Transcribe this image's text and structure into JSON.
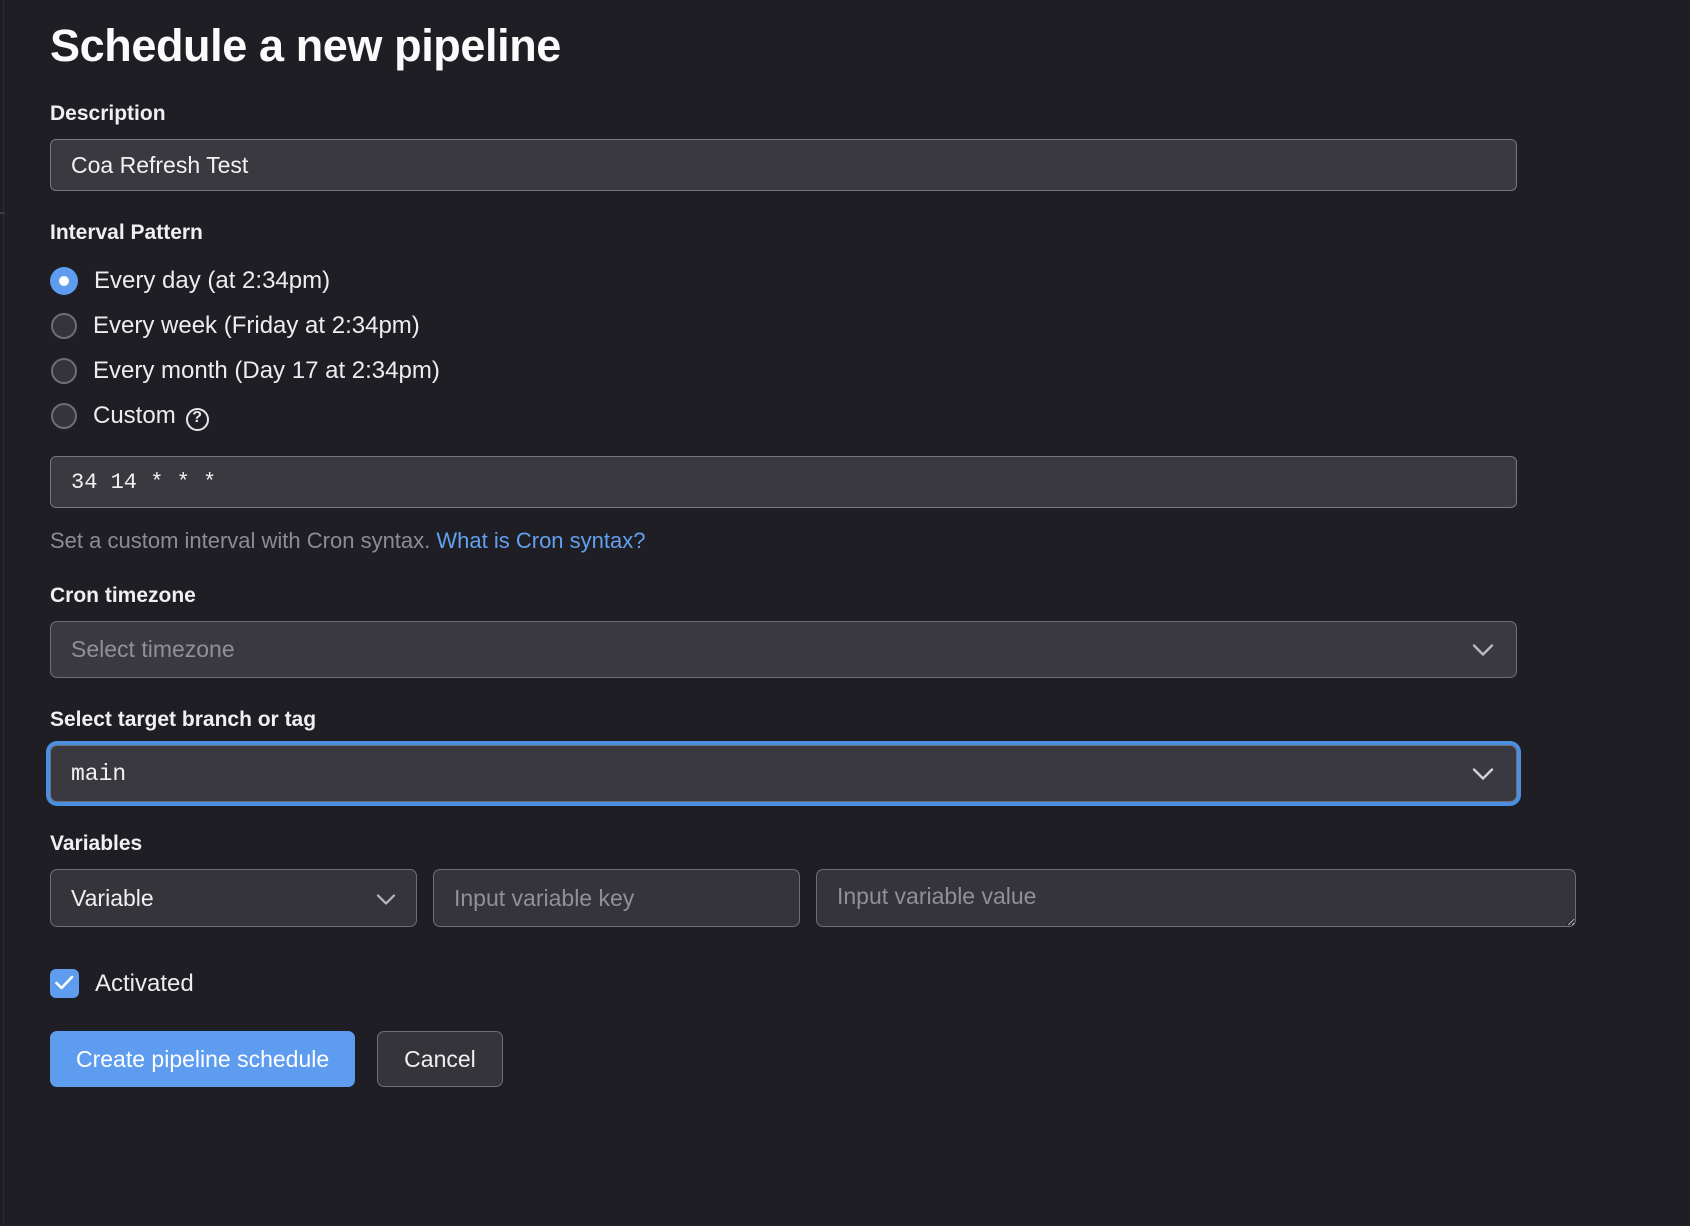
{
  "page": {
    "title": "Schedule a new pipeline"
  },
  "description": {
    "label": "Description",
    "value": "Coa Refresh Test",
    "placeholder": ""
  },
  "interval": {
    "label": "Interval Pattern",
    "selected_index": 0,
    "options": [
      {
        "label": "Every day (at 2:34pm)",
        "checked": true
      },
      {
        "label": "Every week (Friday at 2:34pm)",
        "checked": false
      },
      {
        "label": "Every month (Day 17 at 2:34pm)",
        "checked": false
      },
      {
        "label": "Custom",
        "checked": false,
        "help_icon": "question-mark-circle-icon"
      }
    ],
    "cron_value": "34 14 * * *",
    "cron_placeholder": "",
    "hint_text": "Set a custom interval with Cron syntax.",
    "hint_link": "What is Cron syntax?"
  },
  "timezone": {
    "label": "Cron timezone",
    "value": "",
    "placeholder": "Select timezone",
    "chevron_icon": "chevron-down-icon"
  },
  "branch": {
    "label": "Select target branch or tag",
    "value": "main",
    "chevron_icon": "chevron-down-icon",
    "focused": true
  },
  "variables": {
    "label": "Variables",
    "type_value": "Variable",
    "type_chevron_icon": "chevron-down-icon",
    "key_placeholder": "Input variable key",
    "key_value": "",
    "value_placeholder": "Input variable value",
    "value_value": ""
  },
  "activated": {
    "label": "Activated",
    "checked": true,
    "check_icon": "checkmark-icon"
  },
  "actions": {
    "submit_label": "Create pipeline schedule",
    "cancel_label": "Cancel"
  },
  "colors": {
    "background": "#1f1e24",
    "accent": "#5e9cf0",
    "link": "#63a0ef",
    "input_bg": "#3a3940",
    "border": "#6f6e77",
    "muted_text": "#8d8c95"
  }
}
